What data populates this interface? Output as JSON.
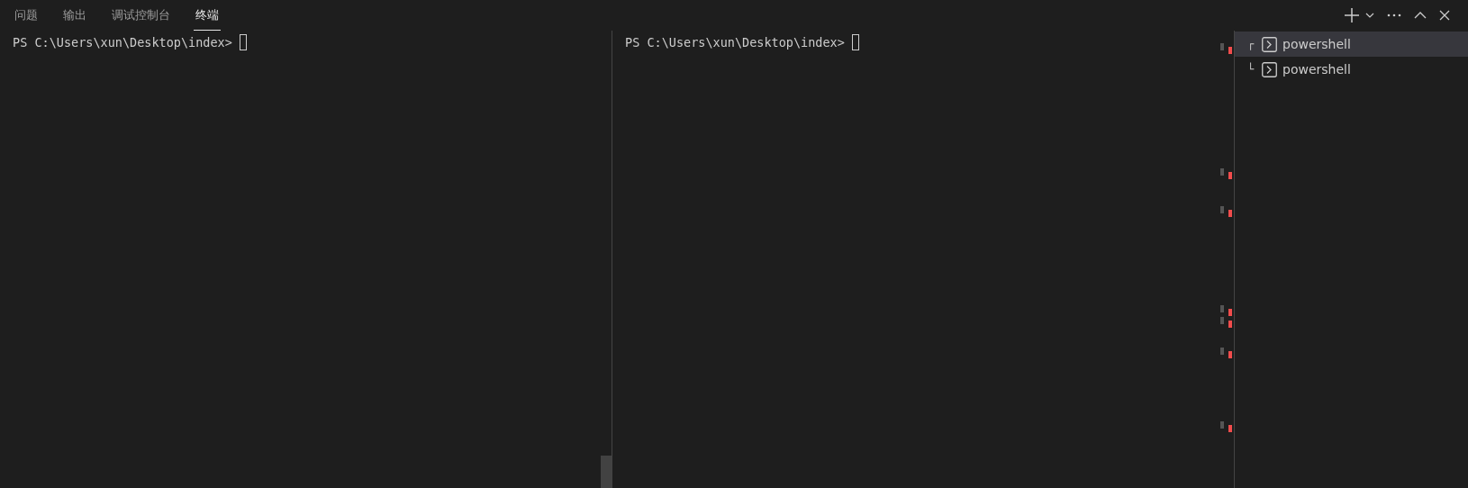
{
  "tabs": [
    {
      "label": "问题",
      "selected": false
    },
    {
      "label": "输出",
      "selected": false
    },
    {
      "label": "调试控制台",
      "selected": false
    },
    {
      "label": "终端",
      "selected": true
    }
  ],
  "terminals": [
    {
      "prompt": "PS C:\\Users\\xun\\Desktop\\index>"
    },
    {
      "prompt": "PS C:\\Users\\xun\\Desktop\\index>"
    }
  ],
  "terminal_list": [
    {
      "label": "powershell",
      "selected": true,
      "tree": "┌"
    },
    {
      "label": "powershell",
      "selected": false,
      "tree": "└"
    }
  ]
}
